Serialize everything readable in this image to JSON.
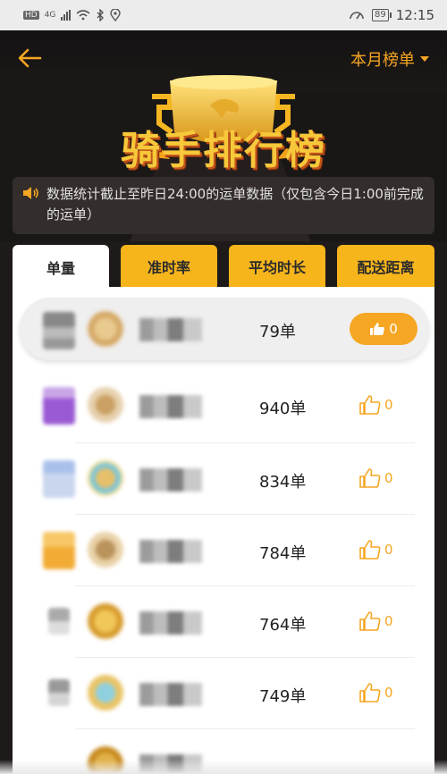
{
  "status_bar": {
    "left_labels": [
      "HD",
      "4G"
    ],
    "battery": "89",
    "time": "12:15"
  },
  "header": {
    "back_icon": "arrow-left-icon",
    "month_label": "本月榜单",
    "title": "骑手排行榜",
    "notice": "数据统计截止至昨日24:00的运单数据（仅包含今日1:00前完成的运单）"
  },
  "tabs": [
    {
      "label": "单量",
      "active": true
    },
    {
      "label": "准时率",
      "active": false
    },
    {
      "label": "平均时长",
      "active": false
    },
    {
      "label": "配送距离",
      "active": false
    }
  ],
  "rows": [
    {
      "orders": "79单",
      "likes": "0",
      "highlight": true
    },
    {
      "orders": "940单",
      "likes": "0",
      "highlight": false
    },
    {
      "orders": "834单",
      "likes": "0",
      "highlight": false
    },
    {
      "orders": "784单",
      "likes": "0",
      "highlight": false
    },
    {
      "orders": "764单",
      "likes": "0",
      "highlight": false
    },
    {
      "orders": "749单",
      "likes": "0",
      "highlight": false
    }
  ],
  "colors": {
    "accent": "#f5a623",
    "tab": "#f7b51c",
    "header_bg": "#1e1a1a"
  }
}
